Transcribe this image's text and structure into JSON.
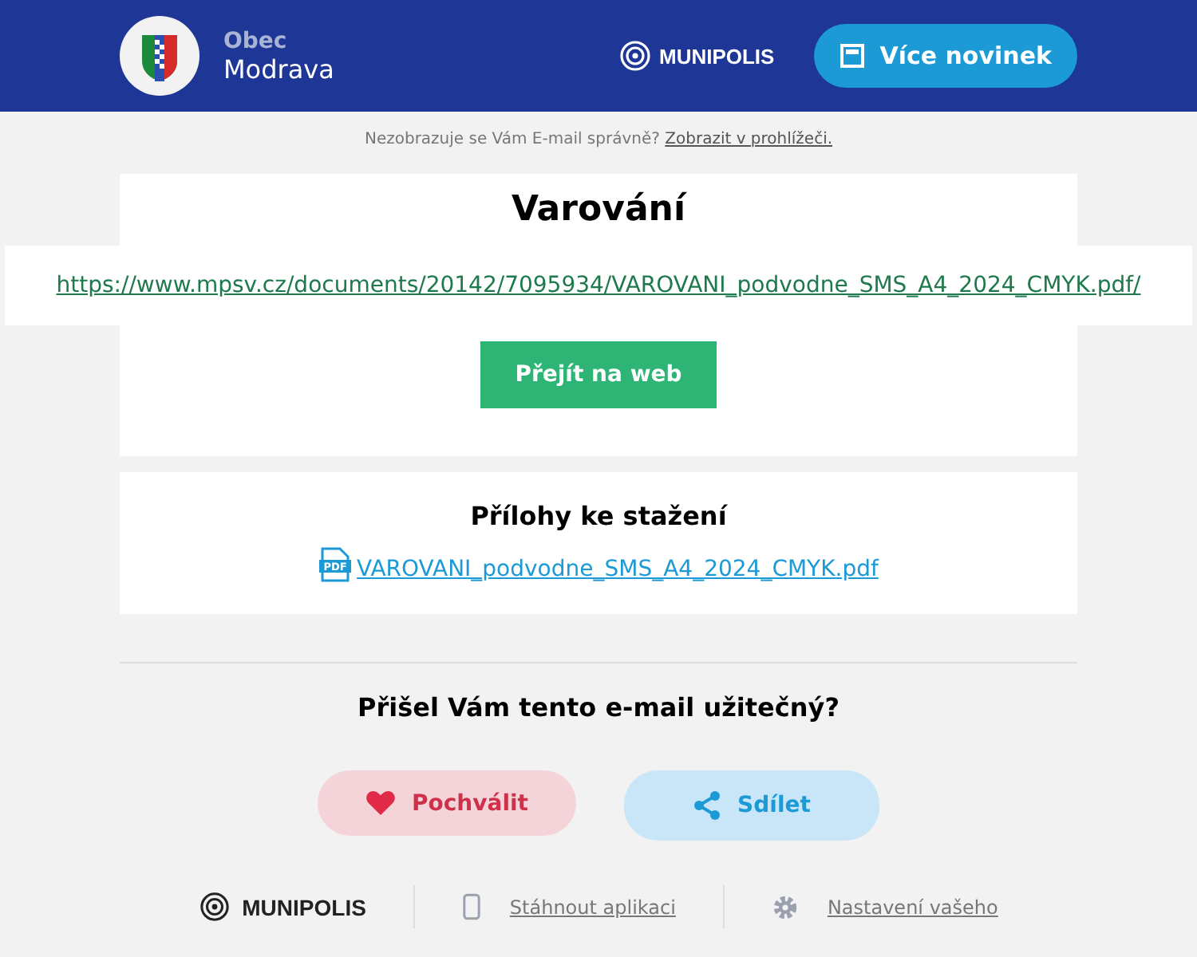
{
  "header": {
    "org_label": "Obec",
    "org_name": "Modrava",
    "brand": "MUNIPOLIS",
    "more_button": "Více novinek"
  },
  "notice": {
    "text": "Nezobrazuje se Vám E-mail správně?",
    "link": "Zobrazit v prohlížeči."
  },
  "article": {
    "title": "Varování",
    "url": "https://www.mpsv.cz/documents/20142/7095934/VAROVANI_podvodne_SMS_A4_2024_CMYK.pdf/",
    "button": "Přejít na web"
  },
  "attachments": {
    "title": "Přílohy ke stažení",
    "files": [
      {
        "name": "VAROVANI_podvodne_SMS_A4_2024_CMYK.pdf",
        "icon_label": "PDF"
      }
    ]
  },
  "feedback": {
    "question": "Přišel Vám tento e-mail užitečný?",
    "buttons": [
      {
        "kind": "like",
        "label": "Pochválit"
      },
      {
        "kind": "share",
        "label": "Sdílet"
      }
    ]
  },
  "footer": {
    "brand": "MUNIPOLIS",
    "links": [
      {
        "kind": "app",
        "label": "Stáhnout aplikaci"
      },
      {
        "kind": "settings",
        "label": "Nastavení vašeho"
      }
    ]
  }
}
